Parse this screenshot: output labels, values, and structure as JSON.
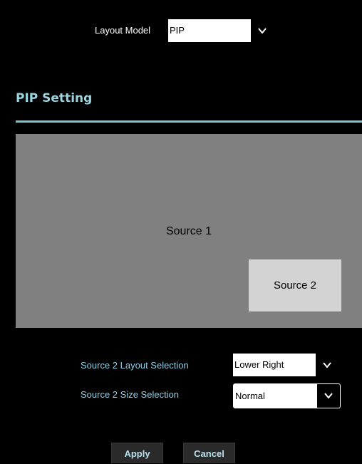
{
  "layout": {
    "label": "Layout Model",
    "value": "PIP",
    "arrow_icon": "chevron-down-icon"
  },
  "section": {
    "title": "PIP Setting"
  },
  "preview": {
    "source1": "Source 1",
    "source2": "Source 2"
  },
  "source2_layout": {
    "label": "Source 2 Layout Selection",
    "value": "Lower Right"
  },
  "source2_size": {
    "label": "Source 2 Size Selection",
    "value": "Normal"
  },
  "buttons": {
    "apply": "Apply",
    "cancel": "Cancel"
  },
  "colors": {
    "background": "#000000",
    "accent": "#7cc6cf",
    "preview_bg": "#808080",
    "source2_bg": "#d3d3d3"
  }
}
